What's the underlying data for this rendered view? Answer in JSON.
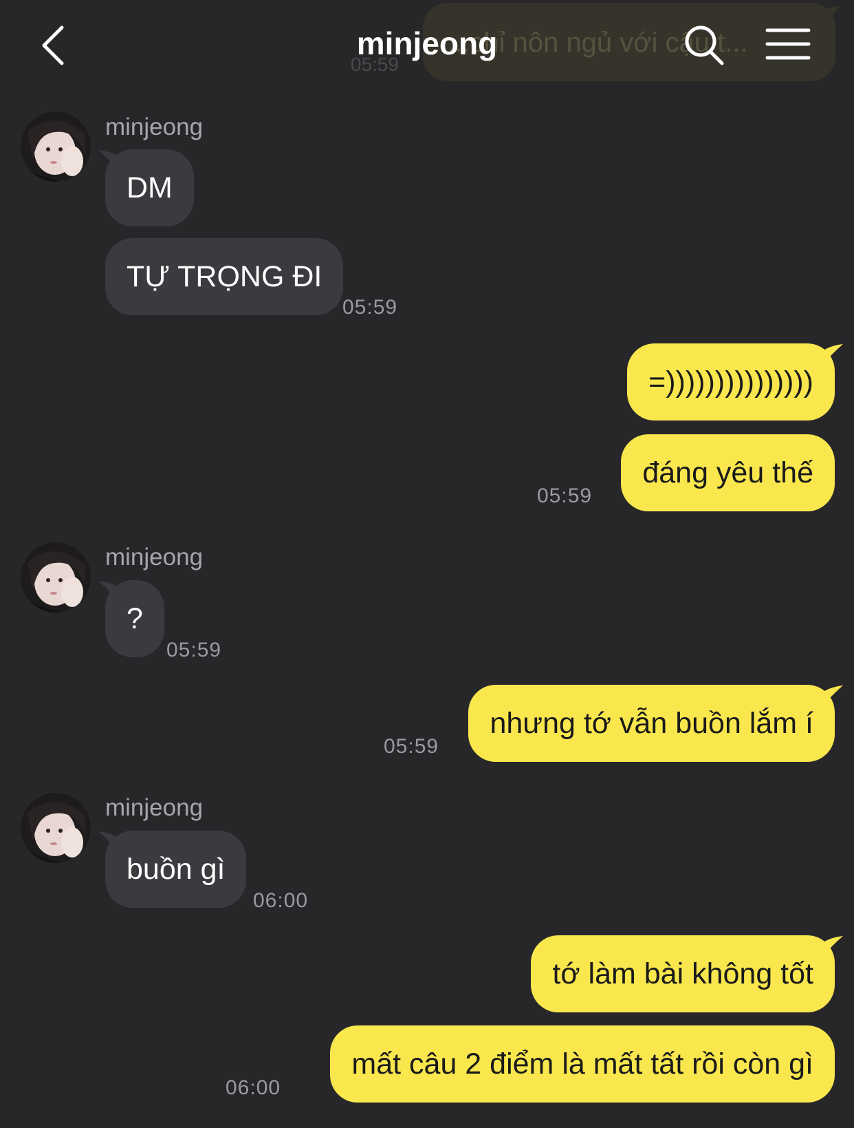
{
  "header": {
    "title": "minjeong",
    "back_icon": "chevron-left-icon",
    "search_icon": "search-icon",
    "menu_icon": "hamburger-menu-icon"
  },
  "pinned_preview": {
    "text": "...chỉ nôn ngủ với cậu t...",
    "time": "05:59"
  },
  "colors": {
    "background": "#27272a",
    "incoming_bubble": "#3b3b3f",
    "outgoing_bubble": "#f9e74d",
    "timestamp": "#9a9a9f"
  },
  "messages": [
    {
      "sender": "minjeong",
      "texts": [
        "DM",
        "TỰ TRỌNG ĐI"
      ],
      "time": "05:59"
    },
    {
      "sender": "me",
      "texts": [
        "=)))))))))))))))",
        "đáng yêu thế"
      ],
      "time": "05:59"
    },
    {
      "sender": "minjeong",
      "texts": [
        "?"
      ],
      "time": "05:59"
    },
    {
      "sender": "me",
      "texts": [
        "nhưng tớ vẫn buồn lắm í"
      ],
      "time": "05:59"
    },
    {
      "sender": "minjeong",
      "texts": [
        "buồn gì"
      ],
      "time": "06:00"
    },
    {
      "sender": "me",
      "texts": [
        "tớ làm bài không tốt",
        "mất câu 2 điểm là mất tất rồi còn gì"
      ],
      "time": "06:00"
    }
  ]
}
